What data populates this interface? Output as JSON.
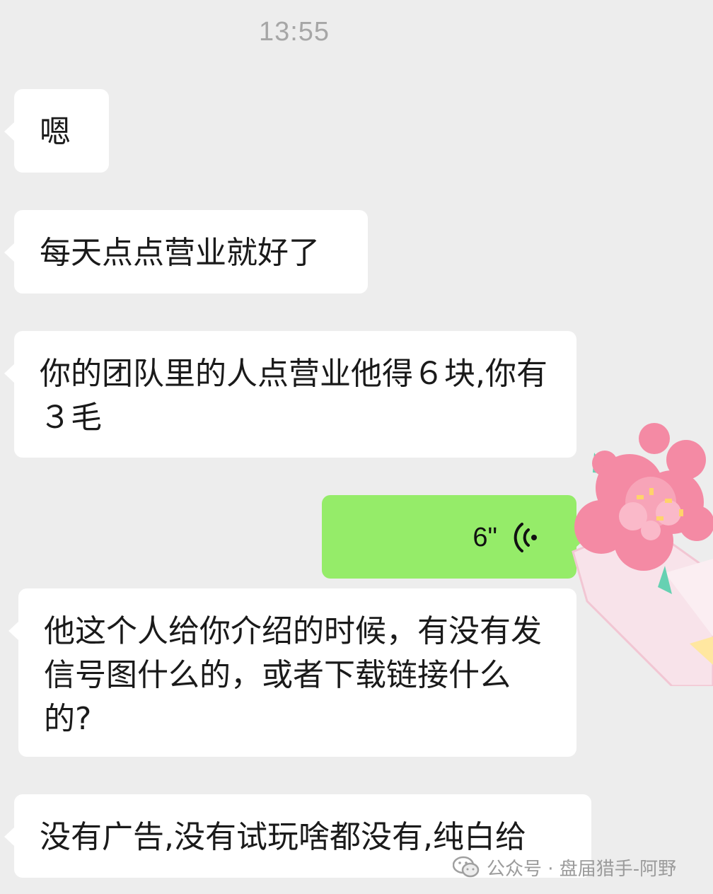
{
  "chat": {
    "timestamp": "13:55",
    "messages": [
      {
        "side": "left",
        "text": "嗯"
      },
      {
        "side": "left",
        "text": "每天点点营业就好了"
      },
      {
        "side": "left",
        "text": "你的团队里的人点营业他得６块,你有３毛"
      },
      {
        "side": "right",
        "type": "voice",
        "duration": "6\""
      },
      {
        "side": "left",
        "text": "他这个人给你介绍的时候，有没有发信号图什么的，或者下载链接什么的?"
      },
      {
        "side": "left",
        "text": "没有广告,没有试玩啥都没有,纯白给"
      }
    ]
  },
  "sticker": {
    "icon": "flower-bouquet-icon"
  },
  "watermark": {
    "icon": "wechat-official-account-icon",
    "text": "公众号 · 盘届猎手-阿野"
  },
  "colors": {
    "background": "#ededed",
    "incoming_bubble": "#ffffff",
    "outgoing_bubble": "#95ec69",
    "timestamp": "#a6a6a6"
  }
}
